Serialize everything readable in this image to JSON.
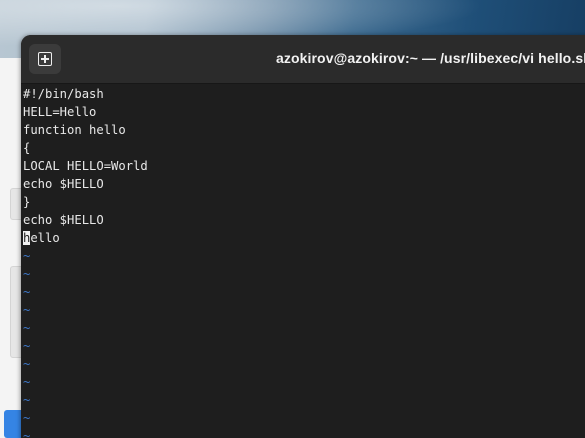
{
  "window": {
    "title": "azokirov@azokirov:~ — /usr/libexec/vi hello.sh",
    "new_tab_icon": "new-tab-icon"
  },
  "editor": {
    "lines": [
      "#!/bin/bash",
      "HELL=Hello",
      "function hello",
      "{",
      "LOCAL HELLO=World",
      "echo $HELLO",
      "}",
      "echo $HELLO"
    ],
    "cursor_line": {
      "cursor_char": "h",
      "rest": "ello"
    },
    "empty_line_marker": "~",
    "empty_line_count": 11
  },
  "colors": {
    "terminal_bg": "#1e1e1e",
    "titlebar_bg": "#2b2b2b",
    "text": "#e8e8e8",
    "tilde": "#3d76c6",
    "accent_blue": "#3584e4"
  }
}
